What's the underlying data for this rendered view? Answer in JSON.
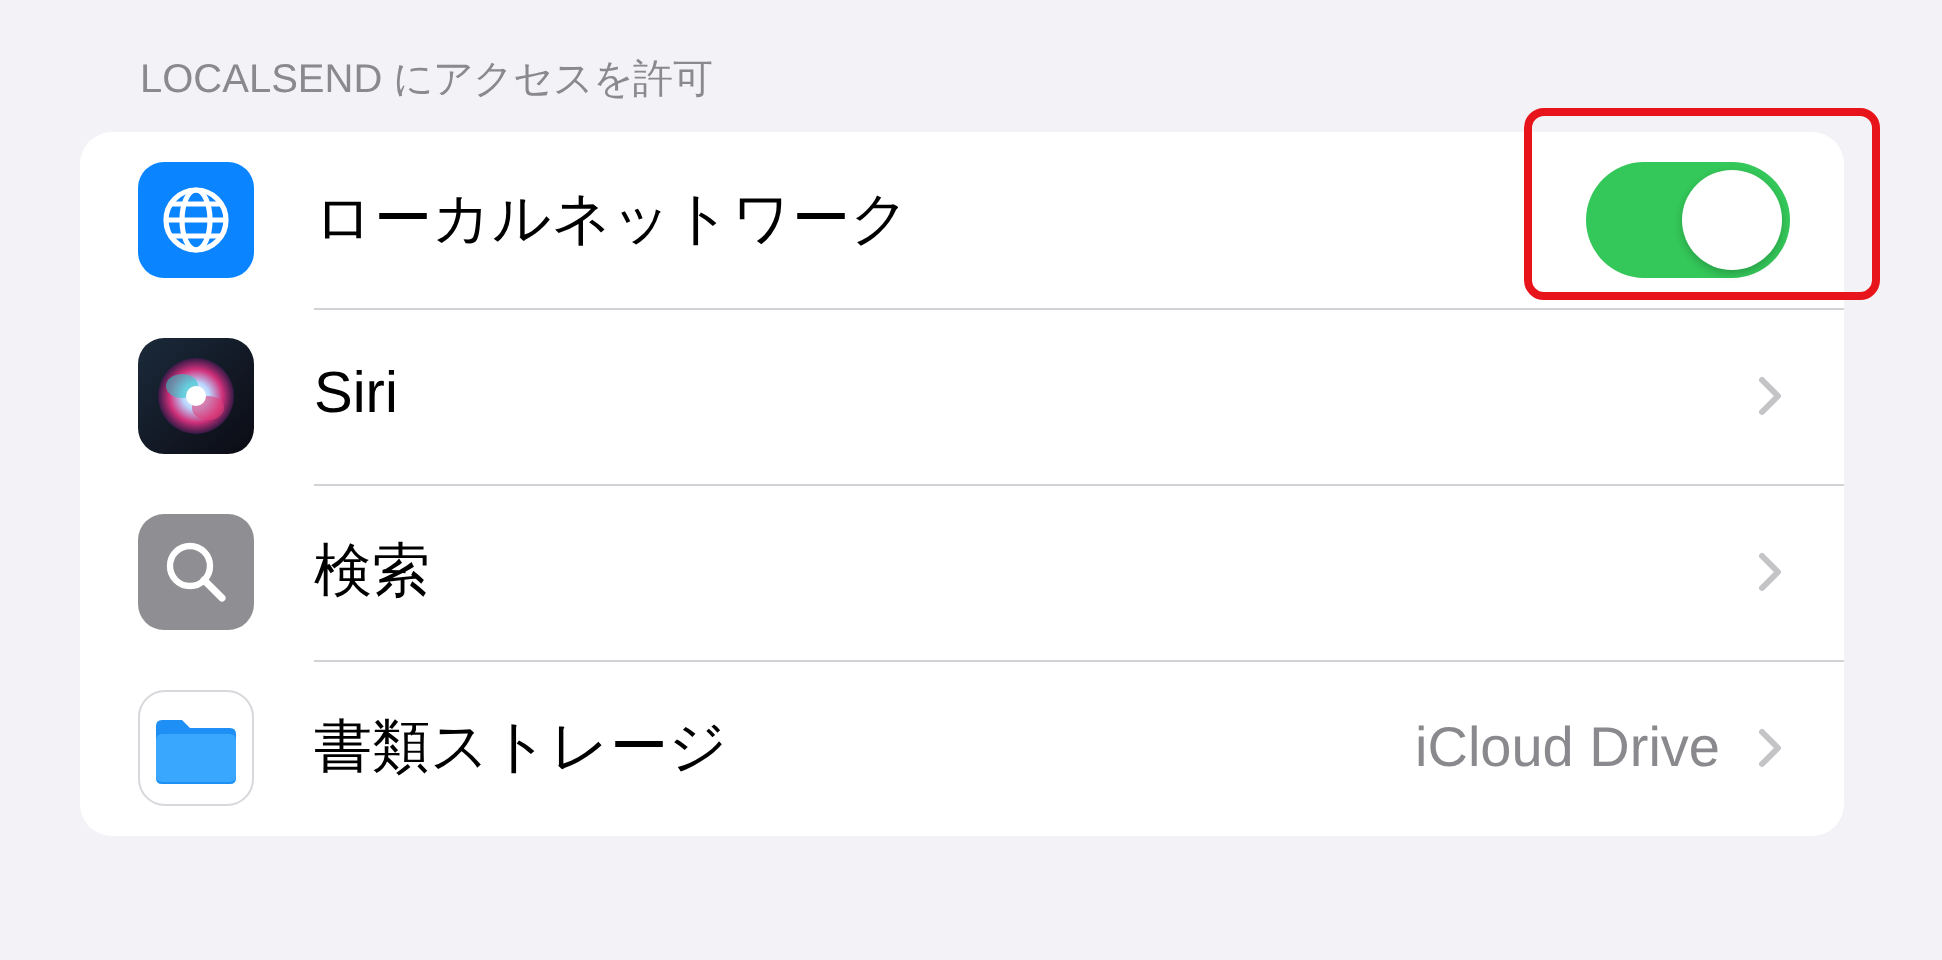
{
  "section_header": "LOCALSEND にアクセスを許可",
  "rows": [
    {
      "kind": "toggle",
      "label": "ローカルネットワーク",
      "on": true,
      "highlighted": true
    },
    {
      "kind": "link",
      "label": "Siri"
    },
    {
      "kind": "link",
      "label": "検索"
    },
    {
      "kind": "link",
      "label": "書類ストレージ",
      "value": "iCloud Drive"
    }
  ]
}
